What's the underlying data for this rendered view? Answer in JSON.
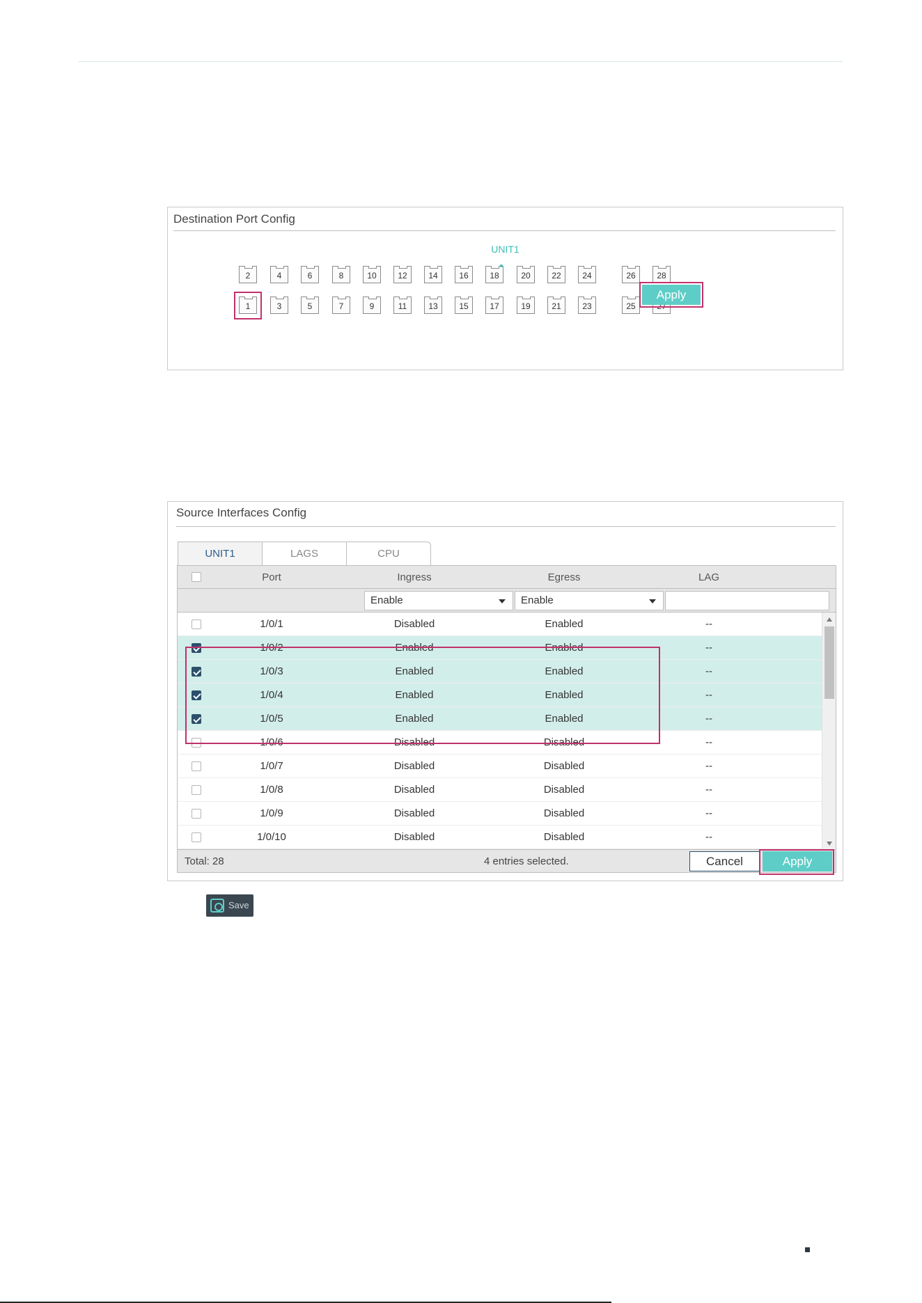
{
  "destination_panel": {
    "title": "Destination Port Config",
    "unit_label": "UNIT1",
    "top_ports": [
      "2",
      "4",
      "6",
      "8",
      "10",
      "12",
      "14",
      "16",
      "18",
      "20",
      "22",
      "24",
      "26",
      "28"
    ],
    "bottom_ports": [
      "1",
      "3",
      "5",
      "7",
      "9",
      "11",
      "13",
      "15",
      "17",
      "19",
      "21",
      "23",
      "25",
      "27"
    ],
    "selected_port": "1",
    "apply_label": "Apply"
  },
  "source_panel": {
    "title": "Source Interfaces Config",
    "tabs": [
      {
        "label": "UNIT1",
        "active": true
      },
      {
        "label": "LAGS",
        "active": false
      },
      {
        "label": "CPU",
        "active": false
      }
    ],
    "columns": {
      "port": "Port",
      "ingress": "Ingress",
      "egress": "Egress",
      "lag": "LAG"
    },
    "filters": {
      "ingress": "Enable",
      "egress": "Enable"
    },
    "rows": [
      {
        "port": "1/0/1",
        "ingress": "Disabled",
        "egress": "Enabled",
        "lag": "--",
        "checked": false
      },
      {
        "port": "1/0/2",
        "ingress": "Enabled",
        "egress": "Enabled",
        "lag": "--",
        "checked": true
      },
      {
        "port": "1/0/3",
        "ingress": "Enabled",
        "egress": "Enabled",
        "lag": "--",
        "checked": true
      },
      {
        "port": "1/0/4",
        "ingress": "Enabled",
        "egress": "Enabled",
        "lag": "--",
        "checked": true
      },
      {
        "port": "1/0/5",
        "ingress": "Enabled",
        "egress": "Enabled",
        "lag": "--",
        "checked": true
      },
      {
        "port": "1/0/6",
        "ingress": "Disabled",
        "egress": "Disabled",
        "lag": "--",
        "checked": false
      },
      {
        "port": "1/0/7",
        "ingress": "Disabled",
        "egress": "Disabled",
        "lag": "--",
        "checked": false
      },
      {
        "port": "1/0/8",
        "ingress": "Disabled",
        "egress": "Disabled",
        "lag": "--",
        "checked": false
      },
      {
        "port": "1/0/9",
        "ingress": "Disabled",
        "egress": "Disabled",
        "lag": "--",
        "checked": false
      },
      {
        "port": "1/0/10",
        "ingress": "Disabled",
        "egress": "Disabled",
        "lag": "--",
        "checked": false
      }
    ],
    "total": "Total: 28",
    "selected_text": "4 entries selected.",
    "cancel_label": "Cancel",
    "apply_label": "Apply"
  },
  "save_button": {
    "label": "Save"
  },
  "colors": {
    "accent": "#5ecdc7",
    "highlight": "#c1306b",
    "checked_row": "#d2eeea",
    "dark": "#2c4f6b"
  }
}
